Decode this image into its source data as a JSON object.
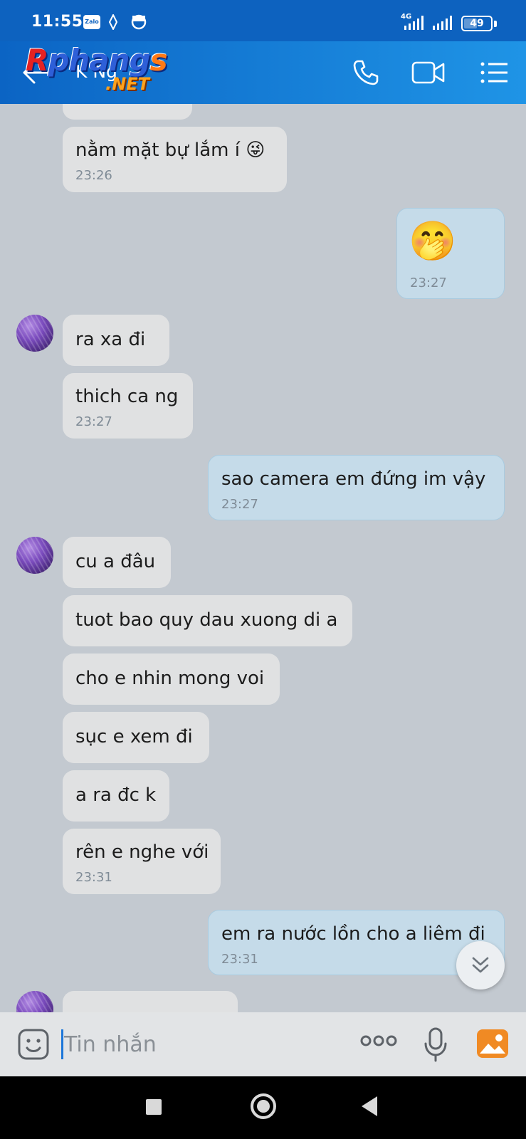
{
  "status_bar": {
    "time": "11:55",
    "zalo_label": "Zalo",
    "network": "4G",
    "battery": "49"
  },
  "header": {
    "contact_name": "K Ng",
    "watermark_line1_r": "R",
    "watermark_line1_mid": "phang",
    "watermark_line1_s": "s",
    "watermark_line2": ".NET"
  },
  "messages": [
    {
      "dir": "in",
      "text": "nằm mặt bự lắm í 😜",
      "time": "23:26"
    },
    {
      "dir": "out",
      "emoji": "🤭",
      "time": "23:27"
    },
    {
      "dir": "in",
      "text": "ra xa đi"
    },
    {
      "dir": "in",
      "text": "thich ca ng",
      "time": "23:27"
    },
    {
      "dir": "out",
      "text": "sao camera em đứng im vậy",
      "time": "23:27"
    },
    {
      "dir": "in",
      "text": "cu a đâu"
    },
    {
      "dir": "in",
      "text": "tuot bao quy dau xuong di a"
    },
    {
      "dir": "in",
      "text": "cho e nhin mong voi"
    },
    {
      "dir": "in",
      "text": "sục e xem đi"
    },
    {
      "dir": "in",
      "text": "a ra đc k"
    },
    {
      "dir": "in",
      "text": "rên e nghe với",
      "time": "23:31"
    },
    {
      "dir": "out",
      "text": "em ra nước lồn cho a liêm đi",
      "time": "23:31"
    }
  ],
  "input": {
    "placeholder": "Tin nhắn"
  },
  "colors": {
    "header_blue": "#0b64c4",
    "chat_bg": "#c3c9d0",
    "incoming_bubble": "#e0e1e2",
    "outgoing_bubble": "#c5dbe9"
  }
}
